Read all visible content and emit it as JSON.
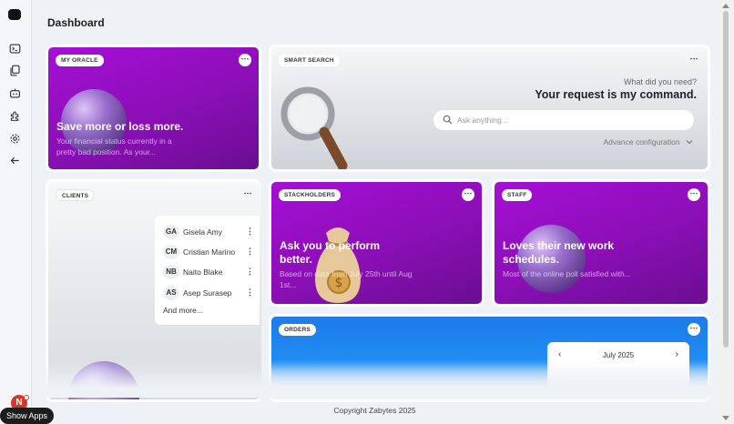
{
  "page": {
    "title": "Dashboard",
    "copyright": "Copyright Zabytes 2025"
  },
  "sidebar": {
    "icons": [
      "terminal-icon",
      "copy-icon",
      "robot-icon",
      "puzzle-icon",
      "settings-icon",
      "back-arrow-icon"
    ]
  },
  "taskbar": {
    "show_apps": "Show Apps",
    "avatar": "N"
  },
  "cards": {
    "oracle": {
      "chip": "MY ORACLE",
      "menu": "⋯",
      "headline": "Save more or loss more.",
      "subtext": "Your financial status currently in a pretty bad position. As your..."
    },
    "search": {
      "chip": "SMART SEARCH",
      "menu": "⋯",
      "question": "What did you need?",
      "headline": "Your request is my command.",
      "placeholder": "Ask anything...",
      "advanced": "Advance configuration"
    },
    "clients": {
      "chip": "CLIENTS",
      "menu": "⋯",
      "items": [
        {
          "initials": "GA",
          "name": "Gisela Amy"
        },
        {
          "initials": "CM",
          "name": "Cristian Marino"
        },
        {
          "initials": "NB",
          "name": "Naito Blake"
        },
        {
          "initials": "AS",
          "name": "Asep Surasep"
        }
      ],
      "more": "And more..."
    },
    "stakeholders": {
      "chip": "STACKHOLDERS",
      "menu": "⋯",
      "headline": "Ask you to perform better.",
      "subtext": "Based on data from July 25th until Aug 1st..."
    },
    "staff": {
      "chip": "STAFF",
      "menu": "⋯",
      "headline": "Loves their new work schedules.",
      "subtext": "Most of the online poll satisfied with..."
    },
    "orders": {
      "chip": "ORDERS",
      "menu": "⋯",
      "calendar_month": "July 2025",
      "prev": "‹",
      "next": "›"
    }
  }
}
